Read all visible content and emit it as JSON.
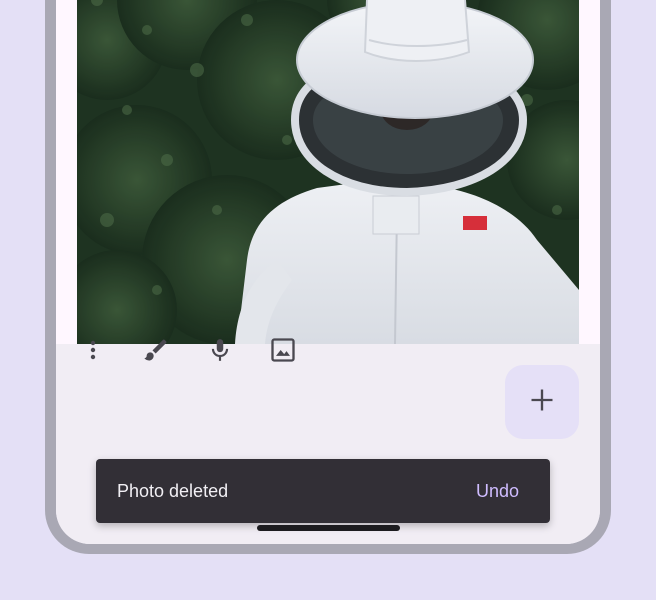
{
  "photo": {
    "subject": "beekeeper-in-protective-suit"
  },
  "toolbar": {
    "items": [
      {
        "icon": "more-vert-icon"
      },
      {
        "icon": "brush-icon"
      },
      {
        "icon": "microphone-icon"
      },
      {
        "icon": "image-icon"
      }
    ],
    "fab_icon": "plus-icon"
  },
  "snackbar": {
    "message": "Photo deleted",
    "action": "Undo"
  },
  "colors": {
    "background": "#e4e0f6",
    "frame": "#a9a8b4",
    "surface": "#f1edf4",
    "fab": "#e5e0f7",
    "snackbar": "#322f36",
    "snackbar_action": "#cfbcff",
    "icon": "#4a4850"
  }
}
